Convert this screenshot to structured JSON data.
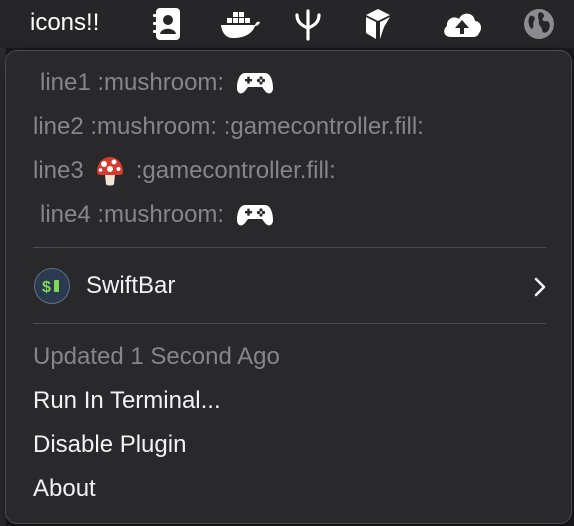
{
  "menubar": {
    "title": "icons!!",
    "icons": [
      "contacts-icon",
      "docker-icon",
      "fork-icon",
      "cube-icon",
      "cloud-upload-icon",
      "globe-icon"
    ]
  },
  "menu": {
    "line1": {
      "text": "line1 :mushroom:",
      "icon": "gamecontroller-icon"
    },
    "line2": {
      "text": "line2 :mushroom: :gamecontroller.fill:"
    },
    "line3": {
      "prefix": "line3",
      "icon": "mushroom-icon",
      "suffix": ":gamecontroller.fill:"
    },
    "line4": {
      "text": "line4 :mushroom:",
      "icon": "gamecontroller-icon"
    },
    "plugin": {
      "label": "SwiftBar",
      "logo_text": "$",
      "icon": "chevron-right-icon"
    },
    "updated": "Updated 1 Second Ago",
    "run_terminal": "Run In Terminal...",
    "disable_plugin": "Disable Plugin",
    "about": "About"
  },
  "colors": {
    "menu_background": "#29292b",
    "dim_text": "#86868a",
    "bright_text": "#f2f2f4",
    "mushroom_red": "#d93a2f"
  }
}
